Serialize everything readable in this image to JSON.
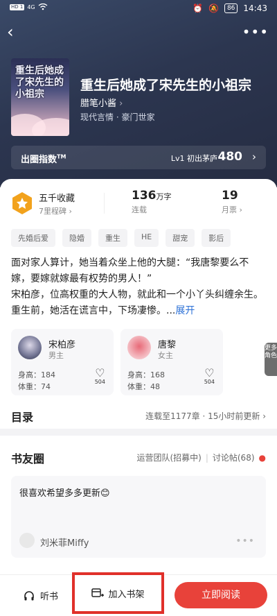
{
  "status": {
    "sim1": "HD 1",
    "sim2": "HD 2",
    "net": "4G",
    "battery": "86",
    "time": "14:43"
  },
  "book": {
    "title": "重生后她成了宋先生的小祖宗",
    "author": "腊笔小酱",
    "genre": "现代言情 · 豪门世家",
    "cover_text": "重生后她成了宋先生的小祖宗"
  },
  "index_bar": {
    "label": "出圈指数",
    "tm": "TM",
    "level": "Lv1 初出茅庐",
    "score": "480"
  },
  "stats": {
    "favorites": "五千收藏",
    "milestones": "7里程碑",
    "words": "136",
    "words_unit": "万字",
    "status": "连载",
    "tickets": "19",
    "tickets_label": "月票"
  },
  "tags": [
    "先婚后爱",
    "隐婚",
    "重生",
    "HE",
    "甜宠",
    "影后"
  ],
  "description": {
    "text": "面对家人算计，她当着众坐上他的大腿：“我唐黎要么不嫁，要嫁就嫁最有权势的男人！”\n宋柏彦，位高权重的大人物，就此和一个小丫头纠缠余生。\n重生前，她活在谎言中，下场凄惨。...",
    "more": "展开"
  },
  "characters": [
    {
      "name": "宋柏彦",
      "role": "男主",
      "height": "身高：184",
      "weight": "体重：74",
      "likes": "504"
    },
    {
      "name": "唐黎",
      "role": "女主",
      "height": "身高：168",
      "weight": "体重：48",
      "likes": "504"
    }
  ],
  "side_more": "更多角色",
  "toc": {
    "title": "目录",
    "info": "连载至1177章 · 15小时前更新"
  },
  "circle": {
    "title": "书友圈",
    "team": "运营团队(招募中)",
    "threads": "讨论帖(68)",
    "post_text": "很喜欢希望多多更新😊",
    "post_user": "刘米菲Miffy"
  },
  "bottom": {
    "listen": "听书",
    "shelf": "加入书架",
    "read": "立即阅读"
  },
  "colors": {
    "accent": "#e8423a",
    "link": "#2a6fd6",
    "header": "#2c3650"
  }
}
